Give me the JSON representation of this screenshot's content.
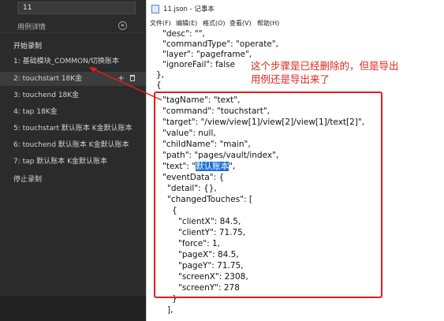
{
  "left_panel": {
    "filename": "11",
    "detail_label": "用例详情",
    "start_recording": "开始录制",
    "steps": [
      {
        "label": "1: 基础模块_COMMON/切换账本",
        "active": false
      },
      {
        "label": "2: touchstart 18K金",
        "active": true,
        "actions": "+ 🗑"
      },
      {
        "label": "3: touchend 18K金",
        "active": false
      },
      {
        "label": "4: tap 18K金",
        "active": false
      },
      {
        "label": "5: touchstart 默认账本 K金默认账本",
        "active": false
      },
      {
        "label": "6: touchend 默认账本 K金默认账本",
        "active": false
      },
      {
        "label": "7: tap 默认账本 K金默认账本",
        "active": false
      }
    ],
    "stop_recording": "停止录制"
  },
  "notepad": {
    "title": "11.json - 记事本",
    "menu": [
      "文件(F)",
      "编辑(E)",
      "格式(O)",
      "查看(V)",
      "帮助(H)"
    ],
    "lines_before": [
      "\"desc\": \"\",",
      "\"commandType\": \"operate\",",
      "\"layer\": \"pageframe\",",
      "\"ignoreFail\": false",
      "},",
      "{"
    ],
    "lines_boxed": [
      "\"tagName\": \"text\",",
      "\"command\": \"touchstart\",",
      "\"target\": \"/view/view[1]/view[2]/view[1]/text[2]\",",
      "\"value\": null,",
      "\"childName\": \"main\",",
      "\"path\": \"pages/vault/index\",",
      "\"text\": \"默认账本\",",
      "\"eventData\": {",
      "\"detail\": {},",
      "\"changedTouches\": [",
      "{",
      "\"clientX\": 84.5,",
      "\"clientY\": 71.75,",
      "\"force\": 1,",
      "\"pageX\": 84.5,",
      "\"pageY\": 71.75,",
      "\"screenX\": 2308,",
      "\"screenY\": 278",
      "}",
      "],"
    ],
    "highlighted_text": "默认账本"
  },
  "annotation": {
    "line1": "这个步骤是已经删除的，但是导出",
    "line2": "用例还是导出来了"
  },
  "colors": {
    "left_bg": "#2b2b2b",
    "highlight": "#1d6fd6",
    "annotation_red": "#e51c1c"
  }
}
